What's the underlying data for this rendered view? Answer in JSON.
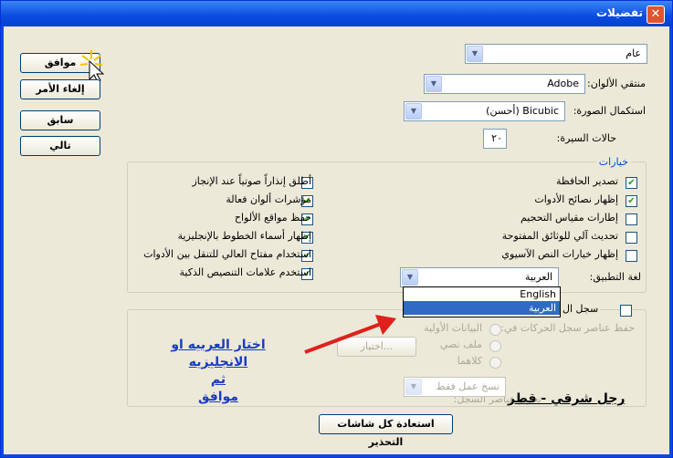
{
  "window": {
    "title": "تفضيلات",
    "close_glyph": "✕"
  },
  "general_combo": {
    "value": "عام"
  },
  "color_picker": {
    "label": "منتقي الألوان:",
    "value": "Adobe"
  },
  "interpolation": {
    "label": "استكمال الصورة:",
    "value": "Bicubic (أحسن)"
  },
  "history_states": {
    "label": "حالات السيرة:",
    "value": "٢٠"
  },
  "side_buttons": {
    "ok": "موافق",
    "cancel": "إلغاء الأمر",
    "prev": "سابق",
    "next": "تالي"
  },
  "options": {
    "legend": "خيارات",
    "right_column": [
      {
        "label": "تصدير الحافظة",
        "checked": true
      },
      {
        "label": "إظهار نصائح الأدوات",
        "checked": true
      },
      {
        "label": "إطارات مقياس التحجيم",
        "checked": false
      },
      {
        "label": "تحديث آلي للوثائق المفتوحة",
        "checked": false
      },
      {
        "label": "إظهار خيارات النص الآسيوي",
        "checked": false
      }
    ],
    "left_column": [
      {
        "label": "أطلق إنذاراً صوتياً عند الإنجاز",
        "checked": false
      },
      {
        "label": "مؤشرات ألوان فعالة",
        "checked": true
      },
      {
        "label": "حفظ مواقع الألواح",
        "checked": true
      },
      {
        "label": "إظهار أسماء الخطوط بالإنجليزية",
        "checked": true
      },
      {
        "label": "استخدام مفتاح العالي للتنقل بين الأدوات",
        "checked": true
      },
      {
        "label": "استخدم علامات التنصيص الذكية",
        "checked": true
      }
    ],
    "ui_language": {
      "label": "لغة التطبيق:",
      "value": "العربية",
      "options": [
        "English",
        "العربية"
      ],
      "selected": "العربية"
    }
  },
  "history_log": {
    "checkbox_label": "سجل ال",
    "save_items_label": "حفظ عناصر سجل الحركات في:",
    "radio_metadata": "البيانات الأولية",
    "radio_textfile": "ملف نصي",
    "radio_both": "كلاهما",
    "choose_button": "اختيار...",
    "edit_items_label": "تحرير عناصر السجل:",
    "edit_items_value": "نسخ عمل فقط"
  },
  "reset_button": "استعادة كل شاشات التحذير",
  "annotation": {
    "line1": "اختار العربيه او الانجليزيه",
    "line2": "ثم",
    "line3": "موافق",
    "signature": "رجل شرقي - قطر"
  },
  "colors": {
    "arrow": "#e0201c",
    "annotation": "#1a3bc6",
    "selection": "#316ac5"
  }
}
